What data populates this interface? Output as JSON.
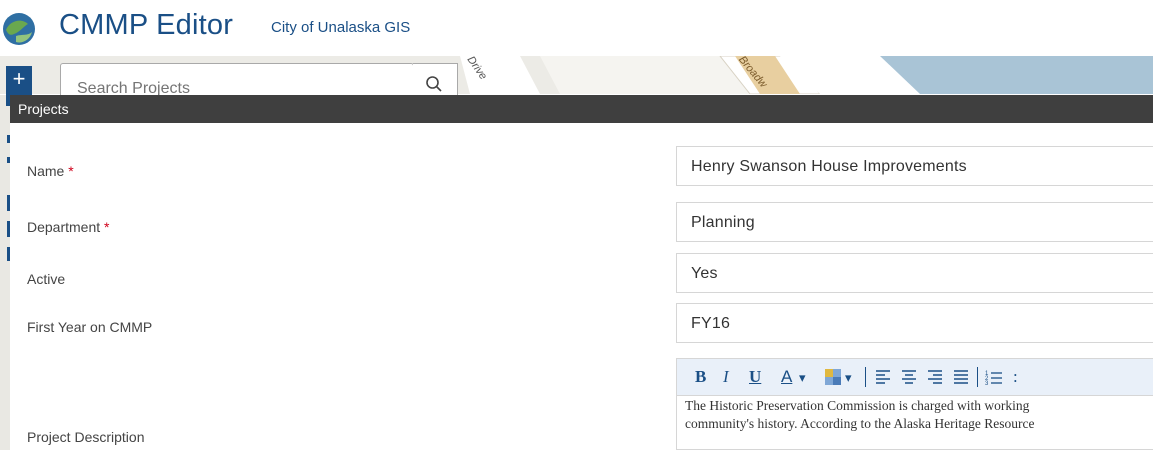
{
  "header": {
    "title": "CMMP Editor",
    "subtitle": "City of Unalaska GIS",
    "brand_color": "#1a4f86"
  },
  "map": {
    "streets": [
      "Drive",
      "Broadw"
    ],
    "search": {
      "placeholder": "Search Projects",
      "value": ""
    },
    "plus_label": "+"
  },
  "panel": {
    "title": "Projects",
    "fields": [
      {
        "label": "Name",
        "required": "*",
        "value": "Henry Swanson House Improvements"
      },
      {
        "label": "Department",
        "required": "*",
        "value": "Planning"
      },
      {
        "label": "Active",
        "value": "Yes"
      },
      {
        "label": "First Year on CMMP",
        "value": "FY16"
      },
      {
        "label": "Project Description",
        "lines": [
          "The Historic Preservation Commission is charged with working",
          "community's history. According to the Alaska Heritage Resource"
        ]
      }
    ]
  },
  "editor_toolbar": {
    "bold": "B",
    "italic": "I",
    "underline": "U",
    "font_color": "A",
    "dropdown": "▾",
    "numbered_list": "1≡",
    "overflow": ":"
  }
}
